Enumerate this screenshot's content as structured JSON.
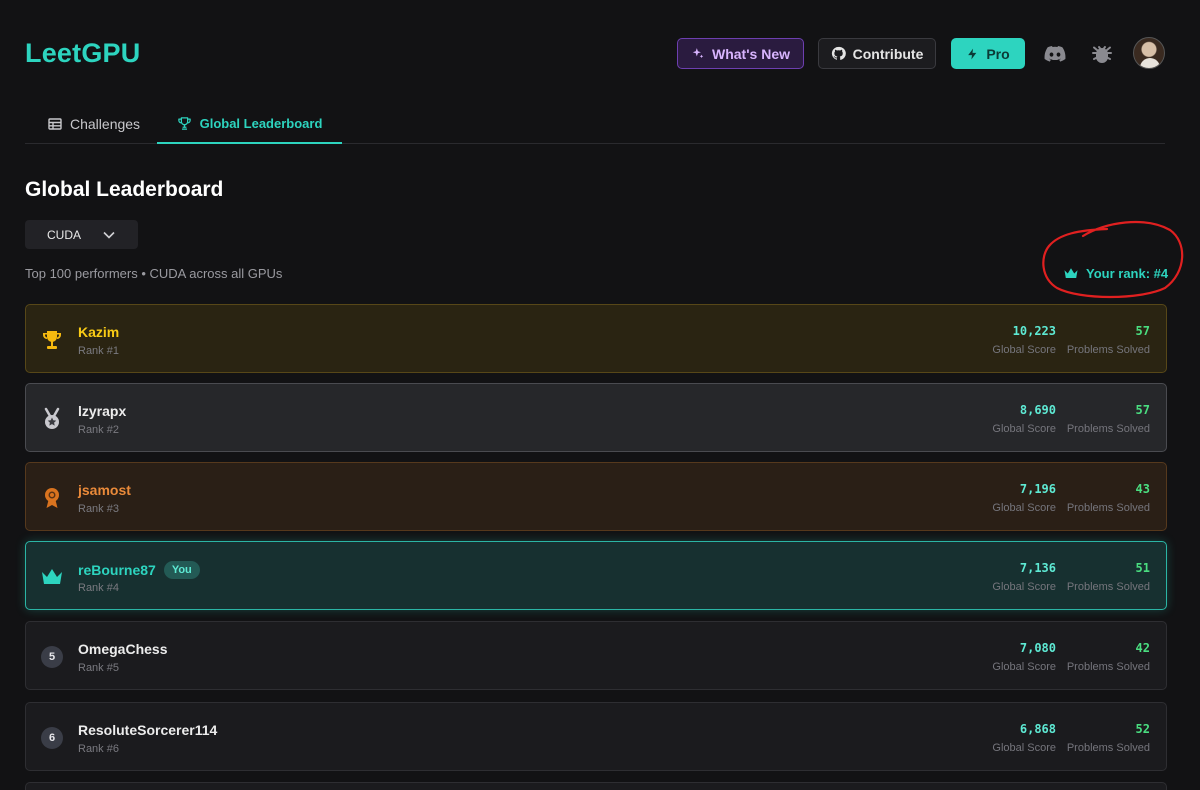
{
  "header": {
    "logo": "LeetGPU",
    "whats_new": "What's New",
    "contribute": "Contribute",
    "pro": "Pro"
  },
  "tabs": [
    {
      "label": "Challenges"
    },
    {
      "label": "Global Leaderboard"
    }
  ],
  "page": {
    "title": "Global Leaderboard",
    "language_select": "CUDA",
    "subtitle": "Top 100 performers • CUDA across all GPUs",
    "your_rank": "Your rank: #4"
  },
  "colors": {
    "accent": "#2dd4bf",
    "gold": "#facc15",
    "bronze": "#ea8a3a",
    "solved": "#4ade80"
  },
  "leaderboard": {
    "score_label": "Global Score",
    "solved_label": "Problems Solved",
    "you_badge": "You",
    "rows": [
      {
        "name": "Kazim",
        "rank": "Rank #1",
        "score": "10,223",
        "solved": "57",
        "icon": "trophy-icon"
      },
      {
        "name": "lzyrapx",
        "rank": "Rank #2",
        "score": "8,690",
        "solved": "57",
        "icon": "silver-medal-icon"
      },
      {
        "name": "jsamost",
        "rank": "Rank #3",
        "score": "7,196",
        "solved": "43",
        "icon": "bronze-award-icon"
      },
      {
        "name": "reBourne87",
        "rank": "Rank #4",
        "score": "7,136",
        "solved": "51",
        "icon": "crown-icon"
      },
      {
        "name": "OmegaChess",
        "rank": "Rank #5",
        "score": "7,080",
        "solved": "42",
        "rank_number": "5"
      },
      {
        "name": "ResoluteSorcerer114",
        "rank": "Rank #6",
        "score": "6,868",
        "solved": "52",
        "rank_number": "6"
      }
    ]
  }
}
